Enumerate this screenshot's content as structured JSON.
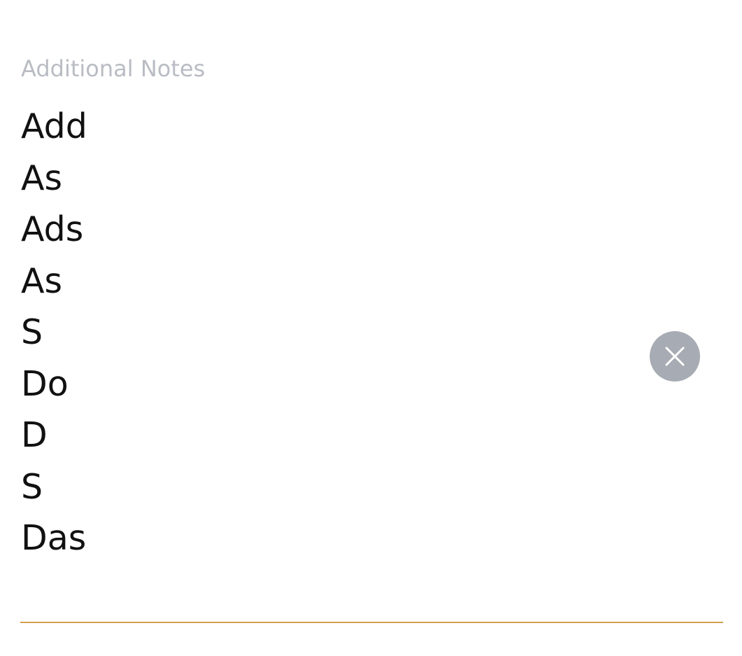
{
  "notes_field": {
    "label": "Additional Notes",
    "lines": [
      "Add",
      "As",
      "Ads",
      "As",
      "S",
      "Do",
      "D",
      "S",
      "Das"
    ],
    "clear_icon": "close-icon",
    "underline_color": "#d4a24f",
    "clear_button_color": "#a7abb3",
    "label_color": "#b9bcc3"
  }
}
